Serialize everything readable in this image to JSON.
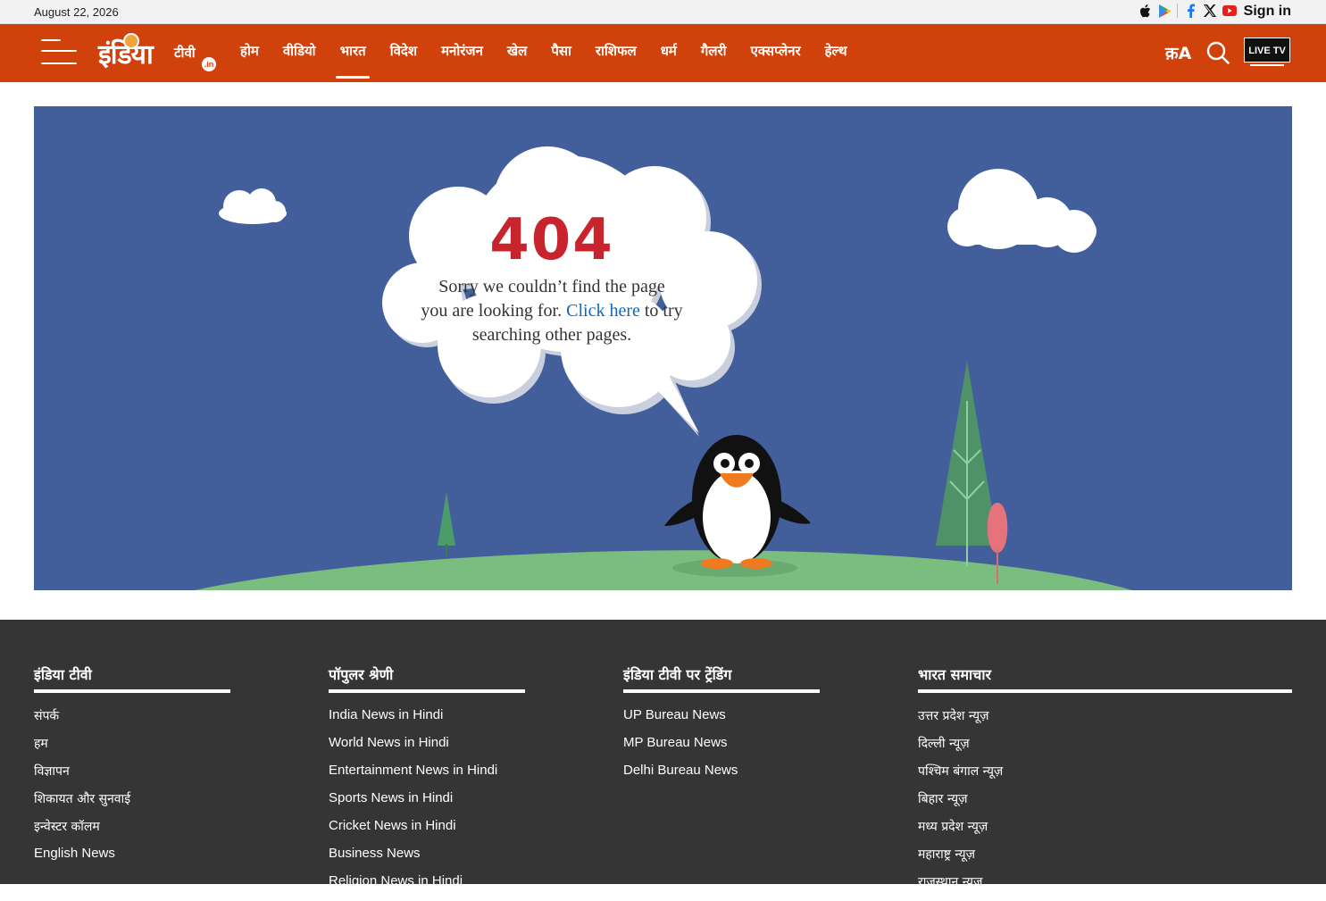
{
  "topbar": {
    "date": "August 22, 2026",
    "social_icons": [
      "apple-icon",
      "google-play-icon",
      "facebook-icon",
      "x-icon",
      "youtube-icon"
    ],
    "signin_label": "Sign in"
  },
  "header": {
    "logo_main": "इंडिया",
    "logo_sub": "टीवी",
    "logo_badge": ".in",
    "nav": [
      "होम",
      "वीडियो",
      "भारत",
      "विदेश",
      "मनोरंजन",
      "खेल",
      "पैसा",
      "राशिफल",
      "धर्म",
      "गैलरी",
      "एक्सप्लेनर",
      "हेल्थ"
    ],
    "active_nav": "भारत",
    "font_toggle": "क़A",
    "live_tv": "LIVE TV"
  },
  "error": {
    "code": "404",
    "line1": "Sorry we couldn’t find the page",
    "line2_pre": "you are looking for.",
    "link": "Click here",
    "line2_post": "to try",
    "line3": "searching other pages."
  },
  "footer": {
    "columns": [
      {
        "title": "इंडिया टीवी",
        "links": [
          "संपर्क",
          "हम",
          "विज्ञापन",
          "शिकायत और सुनवाई",
          "इन्वेस्टर कॉलम",
          "English News"
        ]
      },
      {
        "title": "पॉपुलर श्रेणी",
        "links": [
          "India News in Hindi",
          "World News in Hindi",
          "Entertainment News in Hindi",
          "Sports News in Hindi",
          "Cricket News in Hindi",
          "Business News",
          "Religion News in Hindi"
        ]
      },
      {
        "title": "इंडिया टीवी पर ट्रेंडिंग",
        "links": [
          "UP Bureau News",
          "MP Bureau News",
          "Delhi Bureau News"
        ]
      },
      {
        "title": "भारत समाचार",
        "links": [
          "उत्तर प्रदेश न्यूज़",
          "दिल्ली न्यूज़",
          "पश्चिम बंगाल न्यूज़",
          "बिहार न्यूज़",
          "मध्य प्रदेश न्यूज़",
          "महाराष्ट्र न्यूज़",
          "राजस्थान न्यूज़"
        ]
      }
    ]
  },
  "colors": {
    "brand": "#d1410b",
    "hero_bg": "#425e9b",
    "error_code": "#c8242e",
    "link": "#1566b8",
    "footer_bg": "#353535"
  }
}
